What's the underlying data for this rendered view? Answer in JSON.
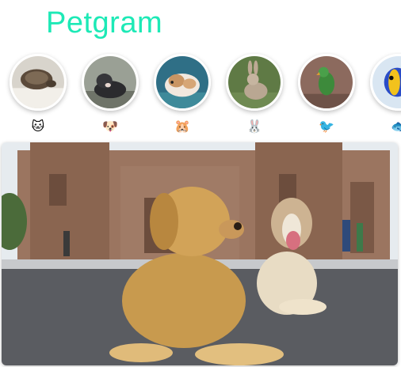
{
  "app": {
    "title": "Petgram",
    "accent": "#1de9b6"
  },
  "stories": [
    {
      "emoji": "🐱",
      "icon": "cat-icon",
      "photo": "turtle-photo"
    },
    {
      "emoji": "🐶",
      "icon": "dog-icon",
      "photo": "dog-photo"
    },
    {
      "emoji": "🐹",
      "icon": "hamster-icon",
      "photo": "hamster-photo"
    },
    {
      "emoji": "🐰",
      "icon": "rabbit-icon",
      "photo": "rabbit-photo"
    },
    {
      "emoji": "🐦",
      "icon": "bird-icon",
      "photo": "parrot-photo"
    },
    {
      "emoji": "🐟",
      "icon": "fish-icon",
      "photo": "fish-photo"
    }
  ],
  "post": {
    "photo": "two-dogs-in-plaza-photo"
  }
}
